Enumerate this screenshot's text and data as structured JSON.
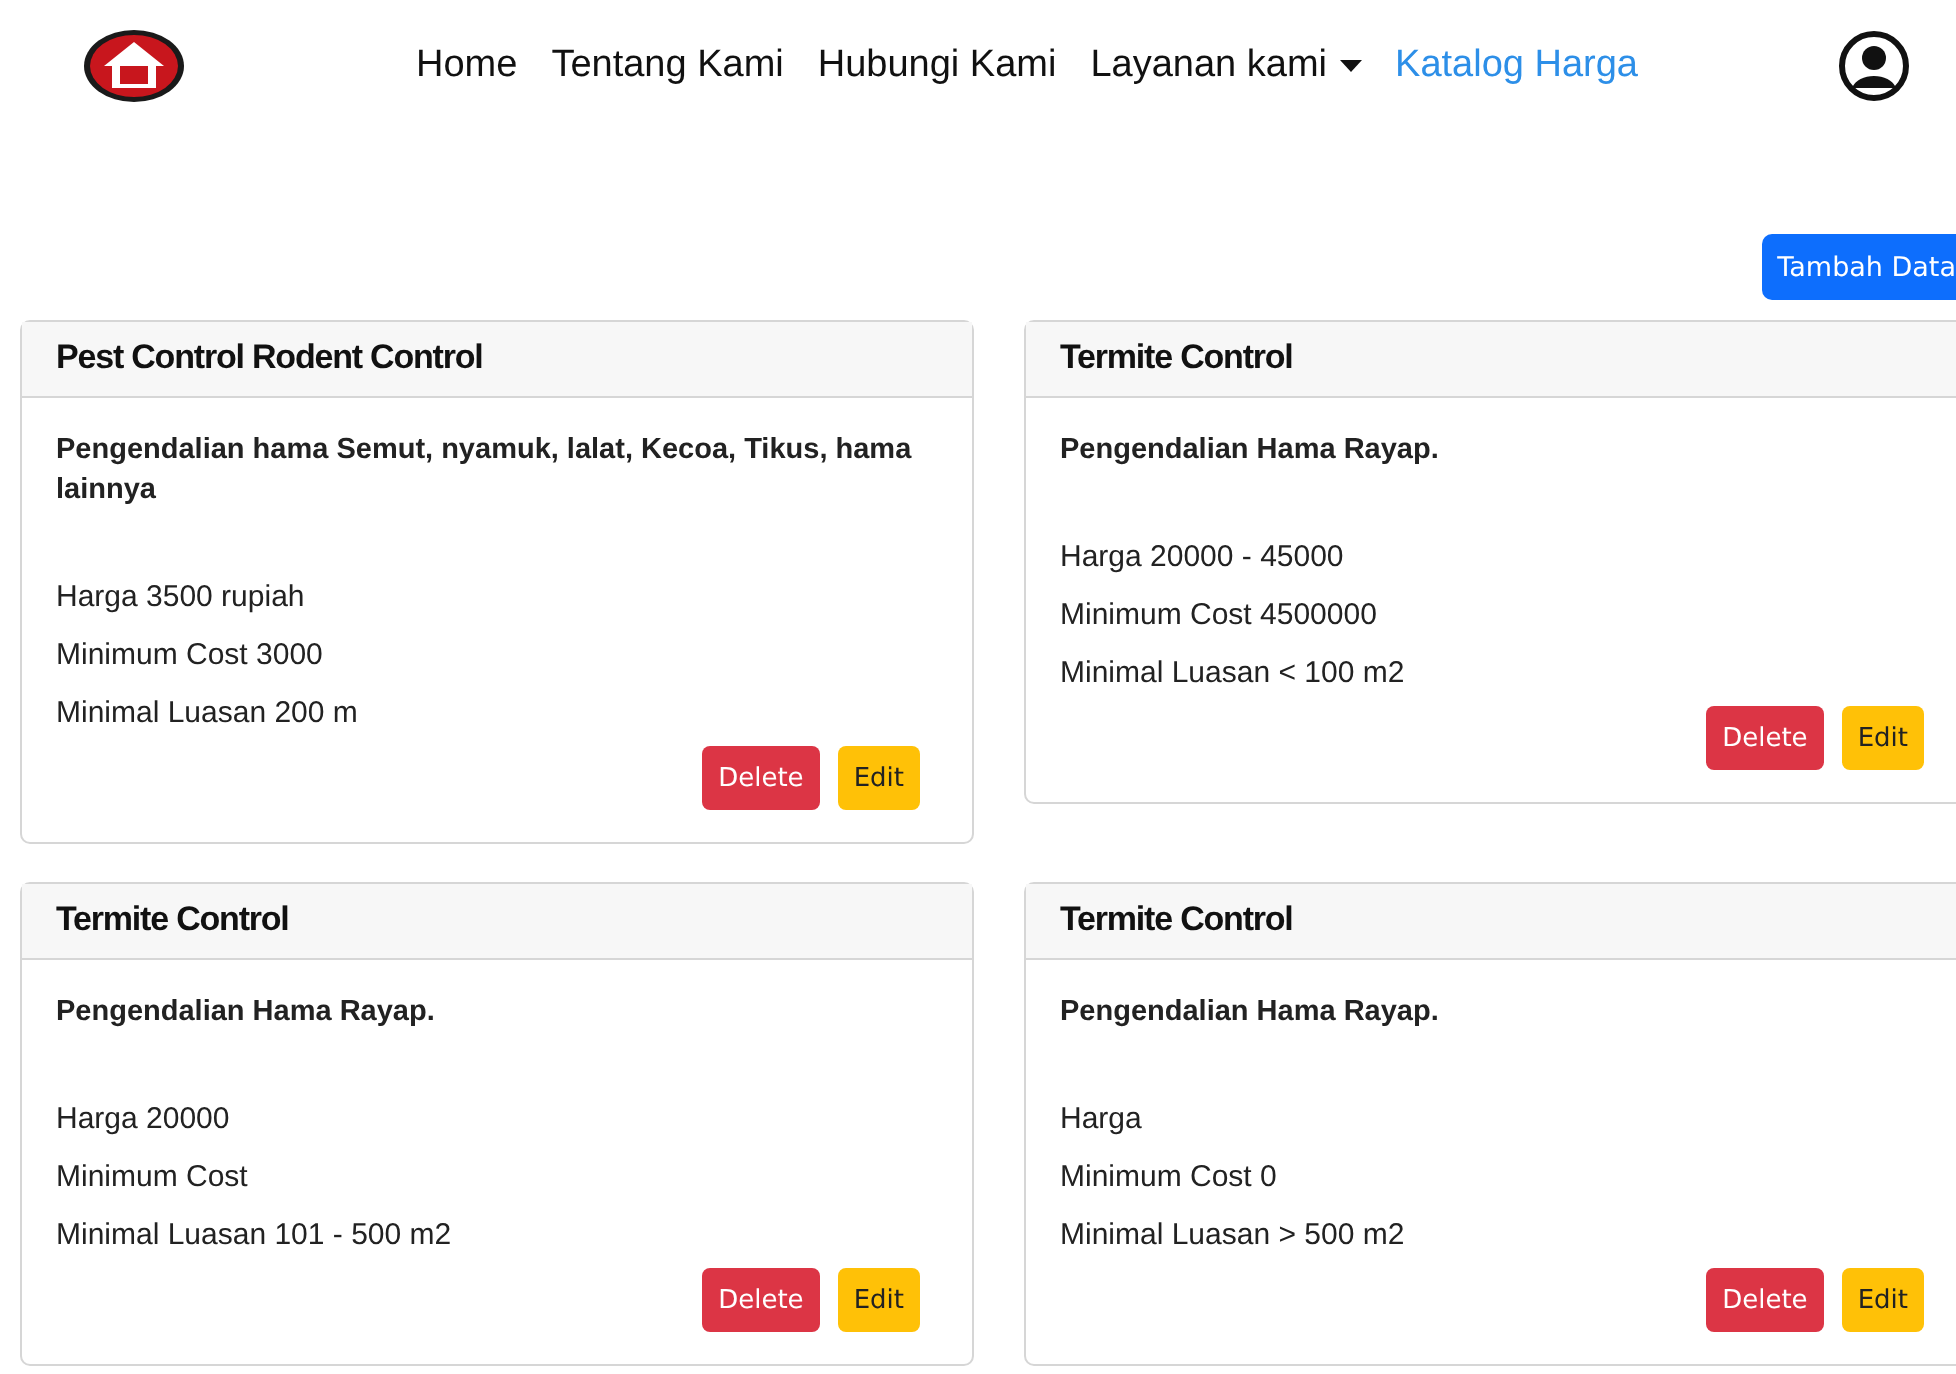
{
  "nav": {
    "items": [
      {
        "label": "Home",
        "selected": false,
        "dropdown": false
      },
      {
        "label": "Tentang Kami",
        "selected": false,
        "dropdown": false
      },
      {
        "label": "Hubungi Kami",
        "selected": false,
        "dropdown": false
      },
      {
        "label": "Layanan kami",
        "selected": false,
        "dropdown": true
      },
      {
        "label": "Katalog Harga",
        "selected": true,
        "dropdown": false
      }
    ]
  },
  "add_button": "Tambah Data",
  "cards": [
    {
      "title": "Pest Control Rodent Control",
      "description": "Pengendalian hama Semut, nyamuk, lalat, Kecoa, Tikus, hama lainnya",
      "lines": [
        "Harga 3500 rupiah",
        "Minimum Cost 3000",
        "Minimal Luasan 200 m"
      ],
      "buttons": [
        {
          "label": "Delete",
          "kind": "danger"
        },
        {
          "label": "Edit",
          "kind": "warning"
        }
      ]
    },
    {
      "title": "Termite Control",
      "description": "Pengendalian Hama Rayap.",
      "lines": [
        "Harga 20000 - 45000",
        "Minimum Cost 4500000",
        "Minimal Luasan < 100 m2"
      ],
      "buttons": [
        {
          "label": "Delete",
          "kind": "danger"
        },
        {
          "label": "Edit",
          "kind": "warning"
        }
      ]
    },
    {
      "title": "Termite Control",
      "description": "Pengendalian Hama Rayap.",
      "lines": [
        "Harga 20000",
        "Minimum Cost",
        "Minimal Luasan 101 - 500 m2"
      ],
      "buttons": [
        {
          "label": "Delete",
          "kind": "danger"
        },
        {
          "label": "Edit",
          "kind": "warning"
        }
      ]
    },
    {
      "title": "Termite Control",
      "description": "Pengendalian Hama Rayap.",
      "lines": [
        "Harga",
        "Minimum Cost 0",
        "Minimal Luasan > 500 m2"
      ],
      "buttons": [
        {
          "label": "Delete",
          "kind": "danger"
        },
        {
          "label": "Edit",
          "kind": "warning"
        }
      ]
    }
  ]
}
